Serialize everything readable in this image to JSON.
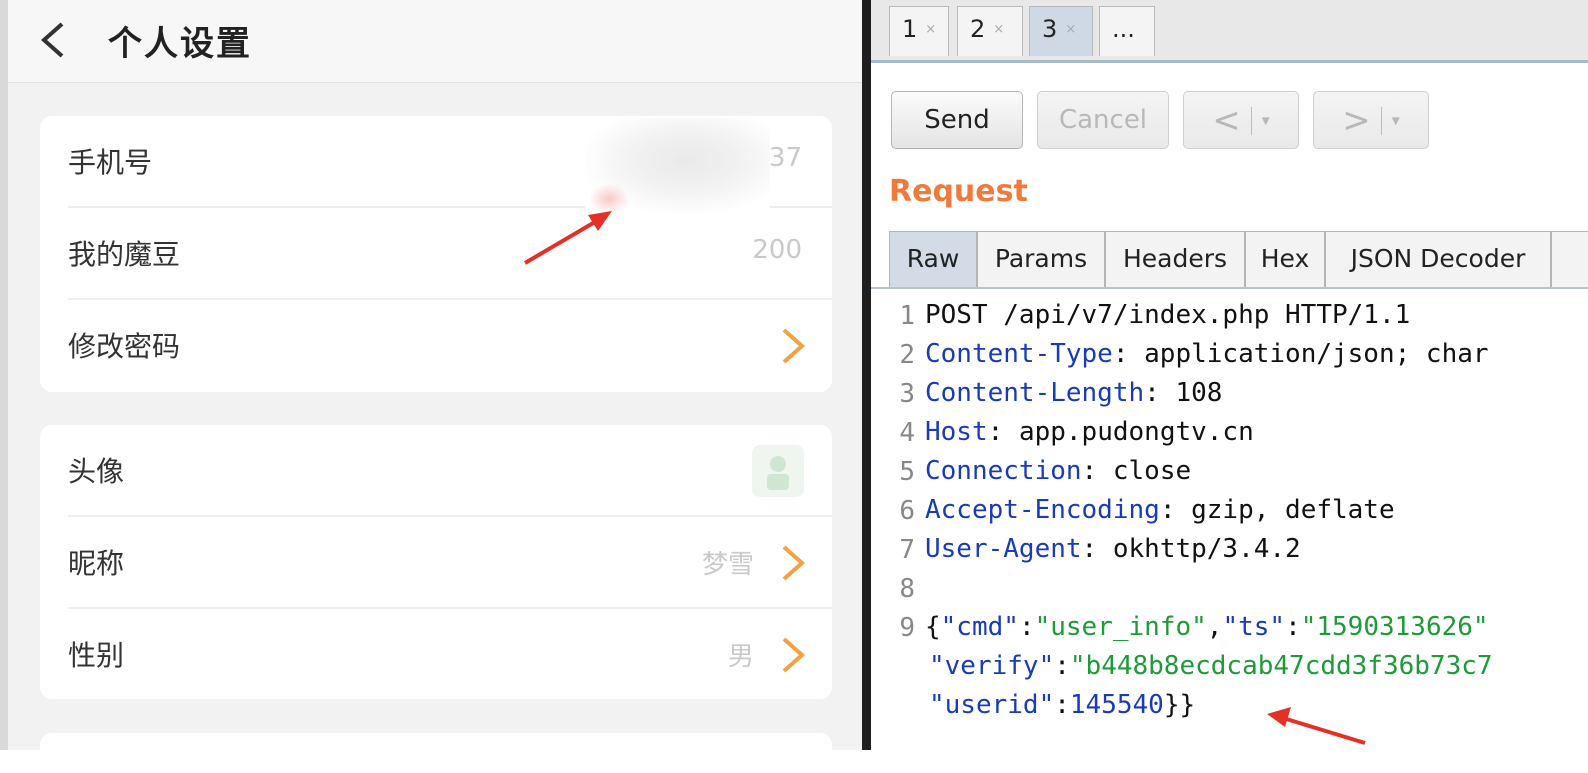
{
  "phone": {
    "title": "个人设置",
    "card1": [
      {
        "label": "手机号",
        "value": "37"
      },
      {
        "label": "我的魔豆",
        "value": "200"
      },
      {
        "label": "修改密码",
        "value": ""
      }
    ],
    "card2": [
      {
        "label": "头像",
        "value": ""
      },
      {
        "label": "昵称",
        "value": "梦雪"
      },
      {
        "label": "性别",
        "value": "男"
      }
    ]
  },
  "burp": {
    "tabs": [
      "1",
      "2",
      "3",
      "..."
    ],
    "tab_close_glyph": "×",
    "buttons": {
      "send": "Send",
      "cancel": "Cancel",
      "back": "<",
      "forward": ">",
      "dropdown": "▾"
    },
    "request_title": "Request",
    "subtabs": [
      "Raw",
      "Params",
      "Headers",
      "Hex",
      "JSON Decoder"
    ],
    "lines": [
      {
        "num": "1",
        "text": "POST /api/v7/index.php HTTP/1.1"
      },
      {
        "num": "2",
        "key": "Content-Type",
        "sep": ": ",
        "val": "application/json; char"
      },
      {
        "num": "3",
        "key": "Content-Length",
        "sep": ": ",
        "val": "108"
      },
      {
        "num": "4",
        "key": "Host",
        "sep": ": ",
        "val": "app.pudongtv.cn"
      },
      {
        "num": "5",
        "key": "Connection",
        "sep": ": ",
        "val": "close"
      },
      {
        "num": "6",
        "key": "Accept-Encoding",
        "sep": ": ",
        "val": "gzip, deflate"
      },
      {
        "num": "7",
        "key": "User-Agent",
        "sep": ": ",
        "val": "okhttp/3.4.2"
      },
      {
        "num": "8",
        "text": ""
      },
      {
        "num": "9"
      }
    ],
    "json_body": {
      "open": "{",
      "k_cmd": "\"cmd\"",
      "v_cmd": "\"user_info\"",
      "k_ts": "\"ts\"",
      "v_ts": "\"1590313626\"",
      "k_verify": "\"verify\"",
      "v_verify": "\"b448b8ecdcab47cdd3f36b73c7",
      "k_userid": "\"userid\"",
      "v_userid": "145540",
      "close": "}}",
      "colon": ":",
      "comma": ","
    }
  }
}
